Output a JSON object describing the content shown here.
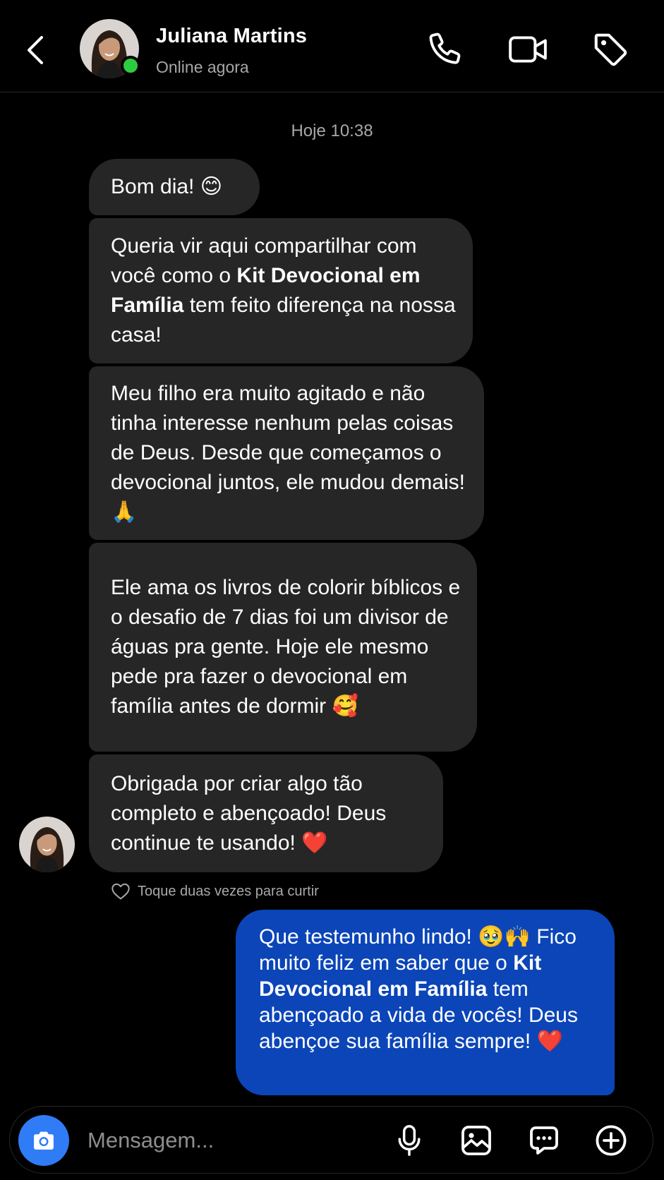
{
  "header": {
    "contact_name": "Juliana Martins",
    "contact_status": "Online agora",
    "icons": [
      "back-icon",
      "phone-icon",
      "video-camera-icon",
      "tag-icon"
    ]
  },
  "thread": {
    "timestamp": "Hoje 10:38",
    "incoming": [
      {
        "text": "Bom dia! 😊"
      },
      {
        "before": "Queria vir aqui compartilhar com você como o ",
        "bold": "Kit Devocional em Família",
        "after": " tem feito diferença na nossa casa!"
      },
      {
        "text": "Meu filho era muito agitado e não tinha interesse nenhum pelas coisas de Deus. Desde que começamos o devocional juntos, ele mudou demais! 🙏"
      },
      {
        "text": "Ele ama os livros de colorir bíblicos e o desafio de 7 dias foi um divisor de águas pra gente. Hoje ele mesmo pede pra fazer o devocional em família antes de dormir 🥰"
      },
      {
        "text": "Obrigada por criar algo tão completo e abençoado! Deus continue te usando! ❤️"
      }
    ],
    "like_hint": "Toque duas vezes para curtir",
    "outgoing": {
      "before": "Que testemunho lindo! 🥹🙌 Fico muito feliz em saber que o ",
      "bold": "Kit Devocional em Família",
      "after": " tem abençoado a vida de vocês! Deus abençoe sua família sempre! ❤️"
    }
  },
  "composer": {
    "placeholder": "Mensagem...",
    "icons": [
      "camera-icon",
      "microphone-icon",
      "image-icon",
      "sticker-icon",
      "plus-icon"
    ]
  },
  "colors": {
    "background": "#000000",
    "incoming_bubble": "#262626",
    "outgoing_bubble": "#0b45b8",
    "online": "#2ecc40",
    "camera_button": "#2f7cf6"
  }
}
